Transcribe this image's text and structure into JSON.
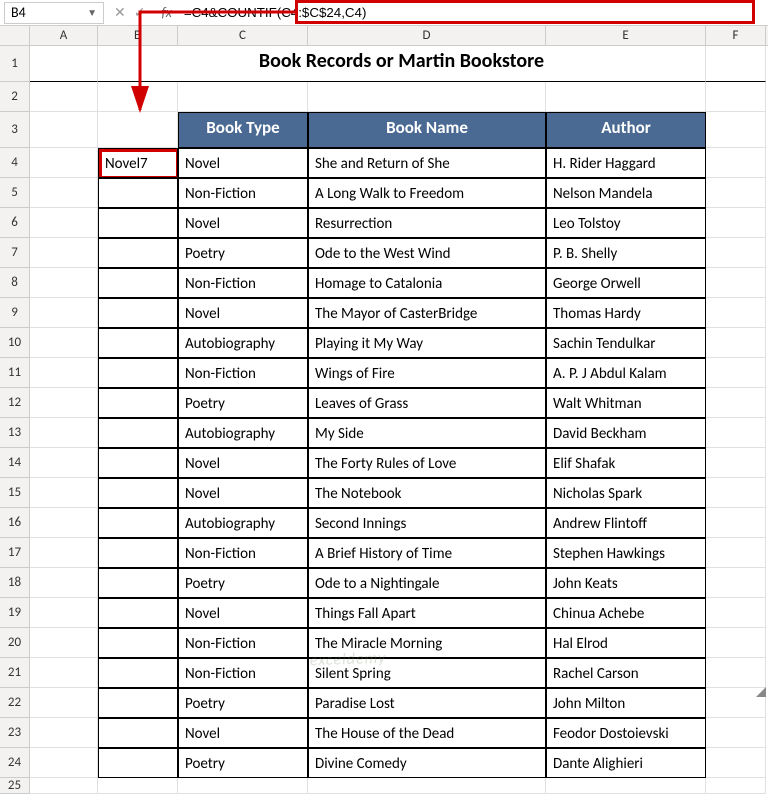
{
  "nameBox": {
    "value": "B4"
  },
  "formulaBar": {
    "fxLabel": "fx",
    "value": "=C4&COUNTIF(C4:$C$24,C4)"
  },
  "columns": [
    "A",
    "B",
    "C",
    "D",
    "E",
    "F"
  ],
  "title": "Book Records or Martin Bookstore",
  "headers": {
    "bookType": "Book Type",
    "bookName": "Book Name",
    "author": "Author"
  },
  "b4Value": "Novel7",
  "rows": [
    {
      "n": "1"
    },
    {
      "n": "2"
    },
    {
      "n": "3"
    },
    {
      "n": "4"
    },
    {
      "n": "5"
    },
    {
      "n": "6"
    },
    {
      "n": "7"
    },
    {
      "n": "8"
    },
    {
      "n": "9"
    },
    {
      "n": "10"
    },
    {
      "n": "11"
    },
    {
      "n": "12"
    },
    {
      "n": "13"
    },
    {
      "n": "14"
    },
    {
      "n": "15"
    },
    {
      "n": "16"
    },
    {
      "n": "17"
    },
    {
      "n": "18"
    },
    {
      "n": "19"
    },
    {
      "n": "20"
    },
    {
      "n": "21"
    },
    {
      "n": "22"
    },
    {
      "n": "23"
    },
    {
      "n": "24"
    },
    {
      "n": "25"
    }
  ],
  "data": [
    {
      "type": "Novel",
      "name": "She and Return of She",
      "author": "H. Rider Haggard"
    },
    {
      "type": "Non-Fiction",
      "name": "A Long Walk to Freedom",
      "author": "Nelson Mandela"
    },
    {
      "type": "Novel",
      "name": "Resurrection",
      "author": "Leo Tolstoy"
    },
    {
      "type": "Poetry",
      "name": "Ode to the West Wind",
      "author": "P. B. Shelly"
    },
    {
      "type": "Non-Fiction",
      "name": "Homage to Catalonia",
      "author": "George Orwell"
    },
    {
      "type": "Novel",
      "name": "The Mayor of CasterBridge",
      "author": "Thomas Hardy"
    },
    {
      "type": "Autobiography",
      "name": "Playing it My Way",
      "author": "Sachin Tendulkar"
    },
    {
      "type": "Non-Fiction",
      "name": "Wings of Fire",
      "author": "A. P. J Abdul Kalam"
    },
    {
      "type": "Poetry",
      "name": "Leaves of Grass",
      "author": "Walt Whitman"
    },
    {
      "type": "Autobiography",
      "name": "My Side",
      "author": "David Beckham"
    },
    {
      "type": "Novel",
      "name": "The Forty Rules of Love",
      "author": "Elif Shafak"
    },
    {
      "type": "Novel",
      "name": "The Notebook",
      "author": "Nicholas Spark"
    },
    {
      "type": "Autobiography",
      "name": "Second Innings",
      "author": "Andrew Flintoff"
    },
    {
      "type": "Non-Fiction",
      "name": "A Brief History of Time",
      "author": "Stephen Hawkings"
    },
    {
      "type": "Poetry",
      "name": "Ode to a Nightingale",
      "author": "John Keats"
    },
    {
      "type": "Novel",
      "name": "Things Fall Apart",
      "author": "Chinua Achebe"
    },
    {
      "type": "Non-Fiction",
      "name": "The Miracle Morning",
      "author": "Hal Elrod"
    },
    {
      "type": "Non-Fiction",
      "name": "Silent Spring",
      "author": "Rachel Carson"
    },
    {
      "type": "Poetry",
      "name": "Paradise Lost",
      "author": "John Milton"
    },
    {
      "type": "Novel",
      "name": "The House of the Dead",
      "author": "Feodor Dostoievski"
    },
    {
      "type": "Poetry",
      "name": "Divine Comedy",
      "author": "Dante Alighieri"
    }
  ],
  "watermark": "exceldemy"
}
